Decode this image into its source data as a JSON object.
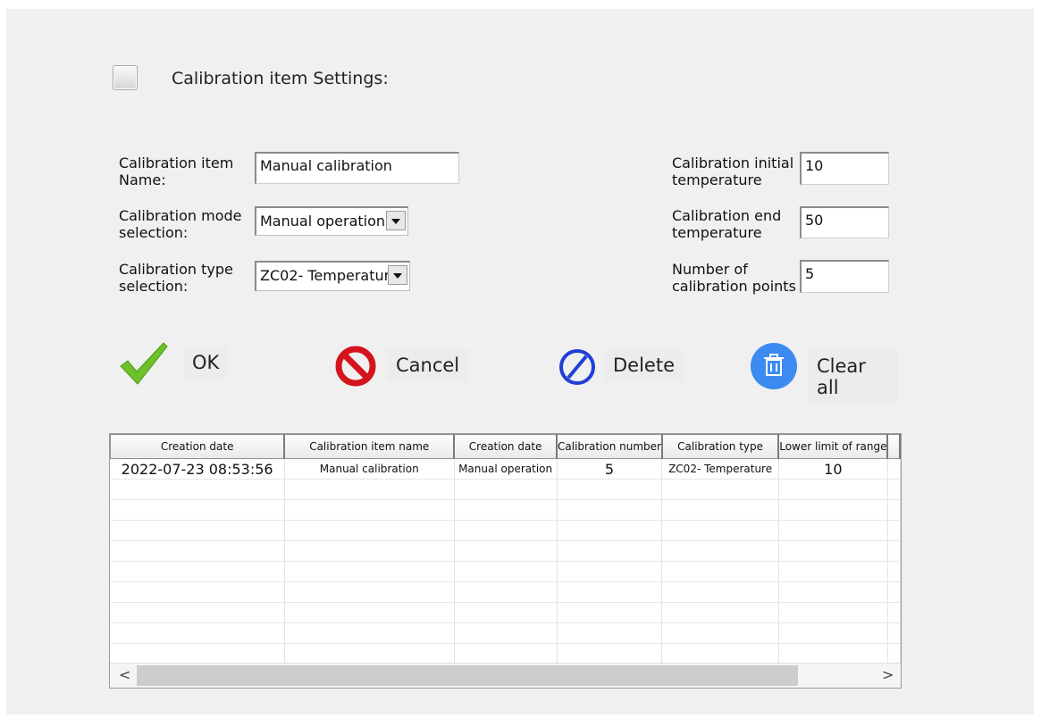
{
  "settings": {
    "title": "Calibration item Settings:",
    "checkbox_checked": false
  },
  "form": {
    "item_name_label": "Calibration item Name:",
    "item_name_value": "Manual calibration",
    "mode_label": "Calibration mode selection:",
    "mode_value": "Manual operation",
    "type_label": "Calibration type selection:",
    "type_value": "ZC02- Temperature",
    "init_temp_label": "Calibration initial temperature",
    "init_temp_value": "10",
    "end_temp_label": "Calibration end temperature",
    "end_temp_value": "50",
    "points_label": "Number of calibration points",
    "points_value": "5"
  },
  "actions": {
    "ok": "OK",
    "cancel": "Cancel",
    "delete": "Delete",
    "clear_all": "Clear all"
  },
  "colors": {
    "ok_check": "#6cc12a",
    "cancel_red": "#d4141c",
    "delete_blue": "#1f3fd6",
    "clear_blue": "#3b8bf0"
  },
  "table": {
    "columns": [
      "Creation date",
      "Calibration item name",
      "Creation date",
      "Calibration number",
      "Calibration type",
      "Lower limit of range"
    ],
    "rows": [
      [
        "2022-07-23 08:53:56",
        "Manual calibration",
        "Manual operation",
        "5",
        "ZC02- Temperature",
        "10"
      ]
    ]
  },
  "scrollbar": {
    "left_arrow": "<",
    "right_arrow": ">"
  }
}
